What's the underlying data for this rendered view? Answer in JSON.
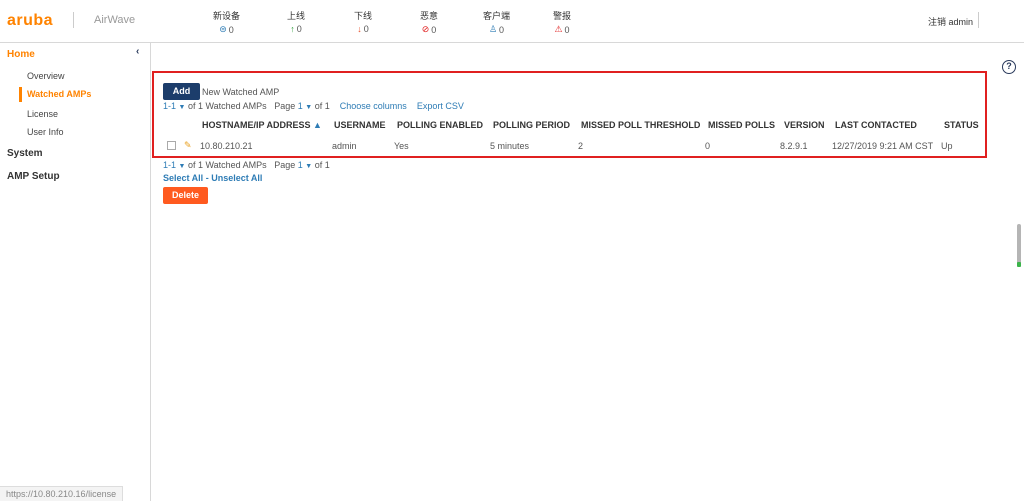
{
  "header": {
    "logo": "aruba",
    "product": "AirWave",
    "stats": [
      {
        "label": "新设备",
        "icon": "⊜",
        "value": "0",
        "color": "#2e7cb5"
      },
      {
        "label": "上线",
        "icon": "↑",
        "value": "0",
        "color": "#2e9e3a"
      },
      {
        "label": "下线",
        "icon": "↓",
        "value": "0",
        "color": "#e8522d"
      },
      {
        "label": "恶意",
        "icon": "⊘",
        "value": "0",
        "color": "#e02020"
      },
      {
        "label": "客户端",
        "icon": "♙",
        "value": "0",
        "color": "#2e7cb5"
      },
      {
        "label": "警报",
        "icon": "⚠",
        "value": "0",
        "color": "#e02020"
      }
    ],
    "user": "注销 admin"
  },
  "sidebar": {
    "home": "Home",
    "items": [
      "Overview",
      "Watched AMPs",
      "License",
      "User Info"
    ],
    "system": "System",
    "amp_setup": "AMP Setup"
  },
  "main": {
    "add_label": "Add",
    "add_text": "New Watched AMP",
    "pager_top": {
      "range": "1-1",
      "of_text": "of 1 Watched AMPs",
      "page_label": "Page",
      "page": "1",
      "page_of": "of 1",
      "choose_columns": "Choose columns",
      "export_csv": "Export CSV"
    },
    "columns": [
      "HOSTNAME/IP ADDRESS",
      "USERNAME",
      "POLLING ENABLED",
      "POLLING PERIOD",
      "MISSED POLL THRESHOLD",
      "MISSED POLLS",
      "VERSION",
      "LAST CONTACTED",
      "STATUS"
    ],
    "sort_indicator": "▲",
    "row": {
      "hostname": "10.80.210.21",
      "username": "admin",
      "polling_enabled": "Yes",
      "polling_period": "5 minutes",
      "missed_poll_threshold": "2",
      "missed_polls": "0",
      "version": "8.2.9.1",
      "last_contacted": "12/27/2019 9:21 AM CST",
      "status": "Up"
    },
    "pager_bottom": {
      "range": "1-1",
      "of_text": "of 1 Watched AMPs",
      "page_label": "Page",
      "page": "1",
      "page_of": "of 1"
    },
    "select_all": "Select All",
    "select_sep": "-",
    "unselect_all": "Unselect All",
    "delete_label": "Delete",
    "help": "?"
  },
  "statusbar": {
    "url": "https://10.80.210.16/license"
  }
}
